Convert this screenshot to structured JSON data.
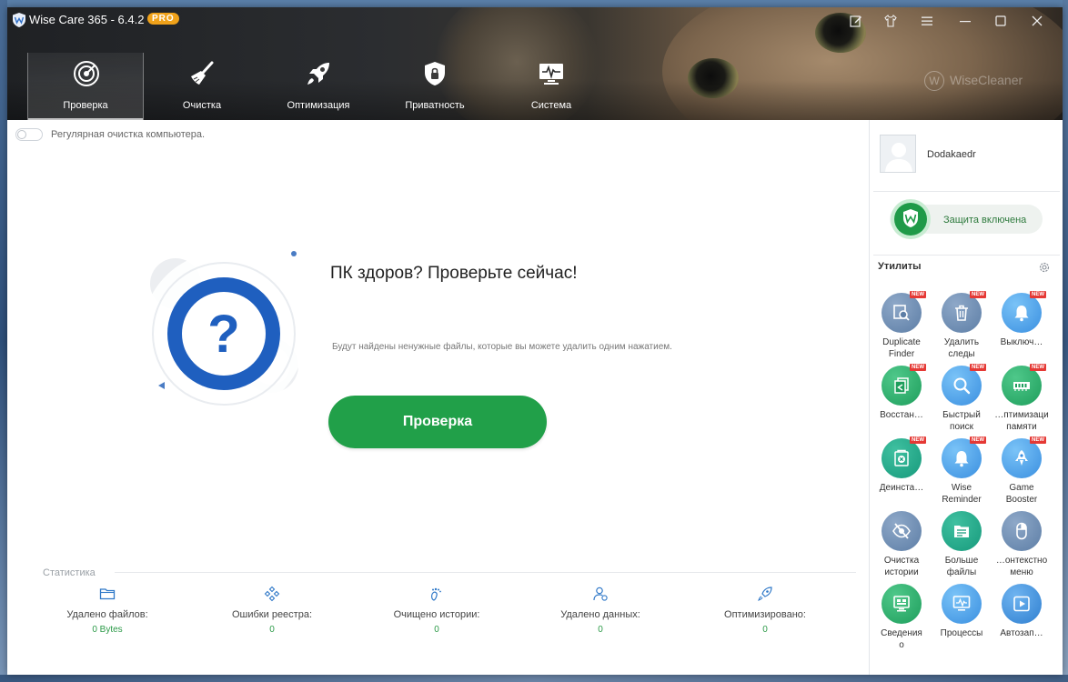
{
  "window": {
    "title": "Wise Care 365 - 6.4.2",
    "badge": "PRO",
    "brand_watermark": "WiseCleaner"
  },
  "nav": [
    {
      "label": "Проверка",
      "icon": "radar-icon",
      "active": true
    },
    {
      "label": "Очистка",
      "icon": "broom-icon",
      "active": false
    },
    {
      "label": "Оптимизация",
      "icon": "rocket-icon",
      "active": false
    },
    {
      "label": "Приватность",
      "icon": "shield-lock-icon",
      "active": false
    },
    {
      "label": "Система",
      "icon": "monitor-pulse-icon",
      "active": false
    }
  ],
  "main": {
    "auto_clean_label": "Регулярная очистка компьютера.",
    "auto_clean_on": false,
    "hero_title": "ПК здоров? Проверьте сейчас!",
    "hero_desc": "Будут найдены ненужные файлы, которые вы можете удалить одним нажатием.",
    "scan_button": "Проверка",
    "stats_title": "Статистика",
    "stats": [
      {
        "label": "Удалено файлов:",
        "value": "0 Bytes",
        "icon": "folder-icon"
      },
      {
        "label": "Ошибки реестра:",
        "value": "0",
        "icon": "registry-icon"
      },
      {
        "label": "Очищено истории:",
        "value": "0",
        "icon": "footprint-icon"
      },
      {
        "label": "Удалено данных:",
        "value": "0",
        "icon": "user-data-icon"
      },
      {
        "label": "Оптимизировано:",
        "value": "0",
        "icon": "rocket-small-icon"
      }
    ]
  },
  "sidebar": {
    "username": "Dodakaedr",
    "protection_label": "Защита включена",
    "utilities_title": "Утилиты",
    "new_badge": "NEW",
    "tools": [
      {
        "label": "Duplicate\nFinder",
        "new": true,
        "icon": "duplicate-finder-icon",
        "color": "slate"
      },
      {
        "label": "Удалить\nследы",
        "new": true,
        "icon": "trash-icon",
        "color": "slate"
      },
      {
        "label": "Выключ…",
        "new": true,
        "icon": "bell-icon",
        "color": "sky"
      },
      {
        "label": "Восстан…",
        "new": true,
        "icon": "restore-icon",
        "color": "green"
      },
      {
        "label": "Быстрый\nпоиск",
        "new": true,
        "icon": "magnifier-icon",
        "color": "sky"
      },
      {
        "label": "…птимизаци\nпамяти",
        "new": true,
        "icon": "memory-icon",
        "color": "green"
      },
      {
        "label": "Деинста…",
        "new": true,
        "icon": "uninstall-icon",
        "color": "teal"
      },
      {
        "label": "Wise\nReminder",
        "new": true,
        "icon": "reminder-bell-icon",
        "color": "sky"
      },
      {
        "label": "Game\nBooster",
        "new": true,
        "icon": "game-rocket-icon",
        "color": "sky"
      },
      {
        "label": "Очистка\nистории",
        "new": false,
        "icon": "eye-off-icon",
        "color": "slate"
      },
      {
        "label": "Больше\nфайлы",
        "new": false,
        "icon": "big-files-icon",
        "color": "teal"
      },
      {
        "label": "…онтекстно\nменю",
        "new": false,
        "icon": "mouse-icon",
        "color": "slate"
      },
      {
        "label": "Сведения\nо",
        "new": false,
        "icon": "system-info-icon",
        "color": "green"
      },
      {
        "label": "Процессы",
        "new": false,
        "icon": "process-monitor-icon",
        "color": "sky"
      },
      {
        "label": "Автозап…",
        "new": false,
        "icon": "play-icon",
        "color": "blue"
      }
    ]
  },
  "colors": {
    "accent_green": "#21a049",
    "ring_blue": "#1f5fbf",
    "stat_value": "#2c9a48",
    "pro_badge": "#f0a21a",
    "new_badge": "#e53935"
  }
}
